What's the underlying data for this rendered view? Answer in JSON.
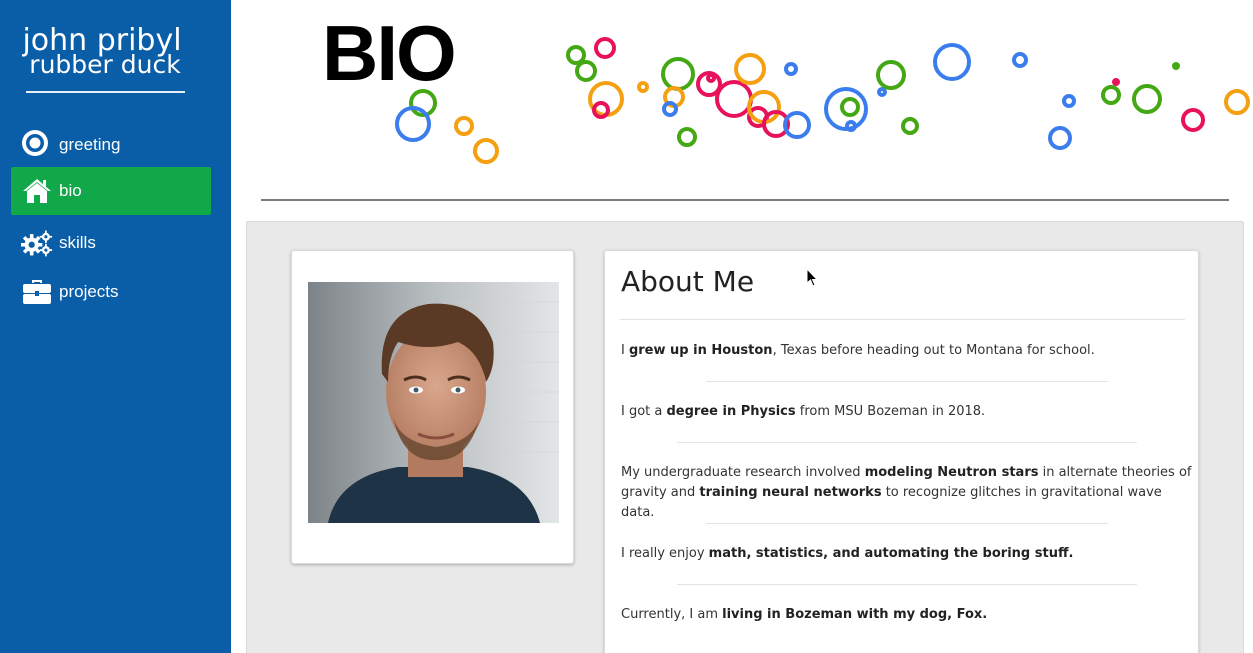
{
  "sidebar": {
    "brand_line1": "john pribyl",
    "brand_line2": "rubber duck",
    "items": [
      {
        "label": "greeting",
        "icon": "dot-circle-icon"
      },
      {
        "label": "bio",
        "icon": "home-icon",
        "active": true
      },
      {
        "label": "skills",
        "icon": "gears-icon"
      },
      {
        "label": "projects",
        "icon": "briefcase-icon"
      }
    ],
    "bg_color": "#0a5ea8",
    "active_color": "#11a84a"
  },
  "header": {
    "title": "BIO"
  },
  "about": {
    "title": "About Me",
    "paragraphs": [
      [
        {
          "t": "I "
        },
        {
          "b": "grew up in Houston"
        },
        {
          "t": ", Texas before heading out to Montana for school."
        }
      ],
      [
        {
          "t": "I got a "
        },
        {
          "b": "degree in Physics"
        },
        {
          "t": " from MSU Bozeman in 2018."
        }
      ],
      [
        {
          "t": "My undergraduate research involved "
        },
        {
          "b": "modeling Neutron stars"
        },
        {
          "t": " in alternate theories of gravity and "
        },
        {
          "b": "training neural networks"
        },
        {
          "t": " to recognize glitches in gravitational wave data."
        }
      ],
      [
        {
          "t": "I really enjoy "
        },
        {
          "b": "math, statistics, and automating the boring stuff."
        }
      ],
      [
        {
          "t": "Currently, I am "
        },
        {
          "b": "living in Bozeman with my dog, Fox."
        }
      ]
    ]
  },
  "colors": {
    "bubble_blue": "#3b7ded",
    "bubble_green": "#44a814",
    "bubble_pink": "#e8115b",
    "bubble_orange": "#f5a011"
  }
}
